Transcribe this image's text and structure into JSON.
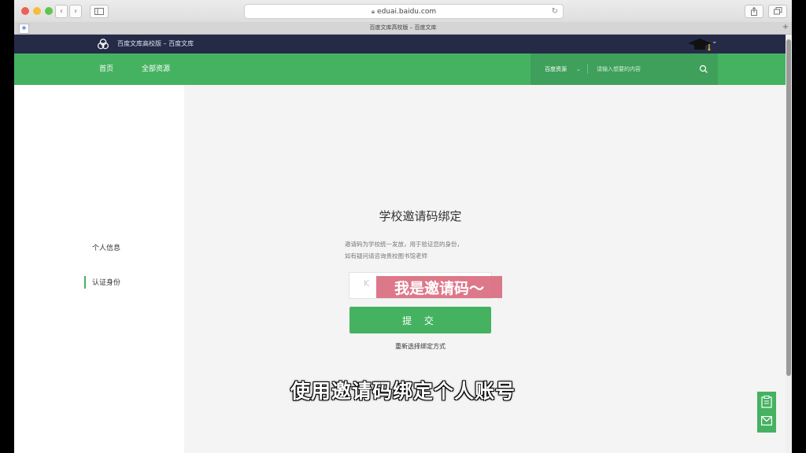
{
  "browser": {
    "url": "eduai.baidu.com",
    "tab_title": "百度文库高校版 – 百度文库",
    "back_glyph": "‹",
    "forward_glyph": "›",
    "reload_glyph": "↻"
  },
  "site": {
    "name": "百度文库高校版 – 百度文库",
    "nav": {
      "home": "首页",
      "all_resources": "全部资源"
    },
    "search": {
      "scope": "百度资源",
      "placeholder": "请输入想要的内容"
    }
  },
  "sidebar": {
    "items": [
      {
        "label": "个人信息",
        "active": false
      },
      {
        "label": "认证身份",
        "active": true
      }
    ]
  },
  "form": {
    "title": "学校邀请码绑定",
    "desc_line1": "邀请码为学校统一发放，用于验证您的身份，",
    "desc_line2": "如有疑问请咨询贵校图书馆老师",
    "code_prefix": "K",
    "code_value": "我是邀请码～",
    "submit": "提 交",
    "rebind": "重新选择绑定方式"
  },
  "caption": "使用邀请码绑定个人账号",
  "colors": {
    "green": "#45b261",
    "navy": "#252b47"
  }
}
